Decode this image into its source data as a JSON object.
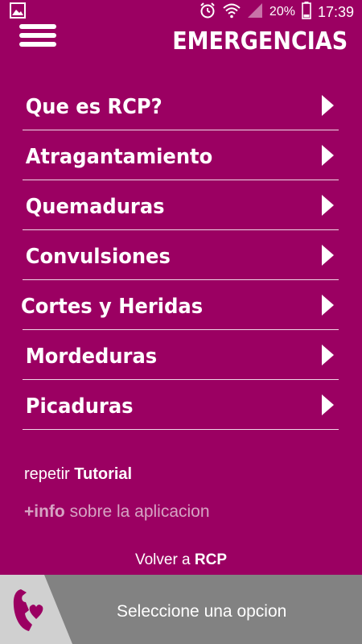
{
  "status_bar": {
    "battery_percent": "20%",
    "time": "17:39",
    "icons": [
      "image-notification-icon",
      "alarm-icon",
      "wifi-icon",
      "signal-icon",
      "battery-icon"
    ]
  },
  "header": {
    "title": "EMERGENCIAS",
    "menu_icon": "hamburger-menu-icon"
  },
  "menu": {
    "items": [
      {
        "label": "Que es RCP?"
      },
      {
        "label": "Atragantamiento"
      },
      {
        "label": "Quemaduras"
      },
      {
        "label": "Convulsiones"
      },
      {
        "label": "Cortes y Heridas"
      },
      {
        "label": "Mordeduras"
      },
      {
        "label": "Picaduras"
      }
    ]
  },
  "links": {
    "tutorial_prefix": "repetir",
    "tutorial_bold": "Tutorial",
    "info_bold": "+info",
    "info_suffix": "sobre la aplicacion",
    "back_prefix": "Volver a",
    "back_bold": "RCP"
  },
  "bottom_bar": {
    "message": "Seleccione una opcion",
    "logo_icon": "phone-heart-icon"
  },
  "colors": {
    "background": "#9b0062",
    "bottom_bar": "#828282",
    "logo_bg": "#d0d0d0",
    "logo_accent": "#9b0062",
    "info_text": "#d6a3c3"
  }
}
